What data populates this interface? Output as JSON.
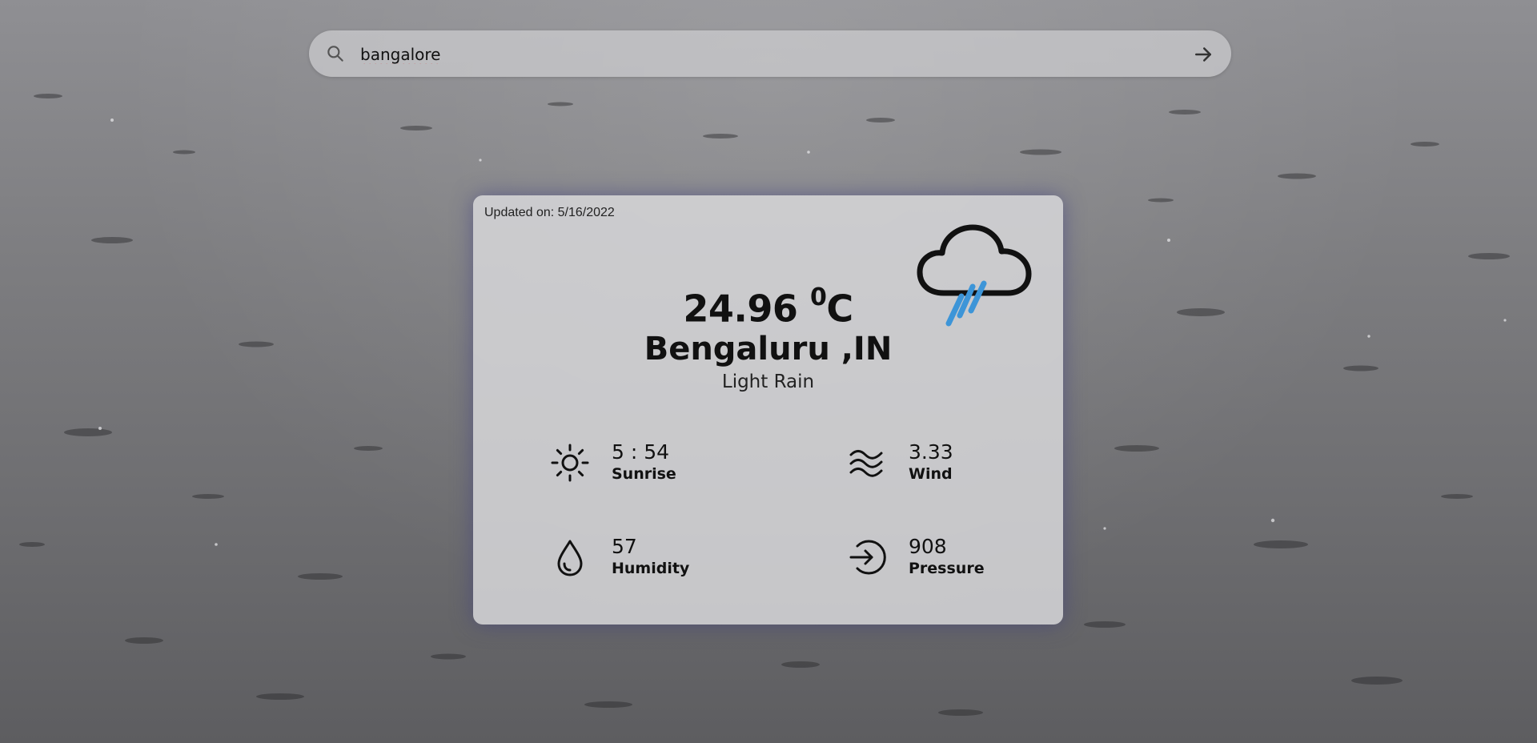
{
  "search": {
    "value": "bangalore",
    "icon": "search-icon",
    "submit_icon": "arrow-right-icon"
  },
  "card": {
    "updated": "Updated on: 5/16/2022",
    "weather_icon": "cloud-rain-icon",
    "temperature": "24.96",
    "temp_unit_sup": "0",
    "temp_unit": "C",
    "city": "Bengaluru ,IN",
    "description": "Light Rain",
    "stats": {
      "sunrise": {
        "value": "5 : 54",
        "label": "Sunrise",
        "icon": "sun-icon"
      },
      "wind": {
        "value": "3.33",
        "label": "Wind",
        "icon": "wind-waves-icon"
      },
      "humidity": {
        "value": "57",
        "label": "Humidity",
        "icon": "droplet-icon"
      },
      "pressure": {
        "value": "908",
        "label": "Pressure",
        "icon": "arrow-circle-icon"
      }
    }
  },
  "colors": {
    "rain_accent": "#3d95d8",
    "text": "#111111"
  }
}
